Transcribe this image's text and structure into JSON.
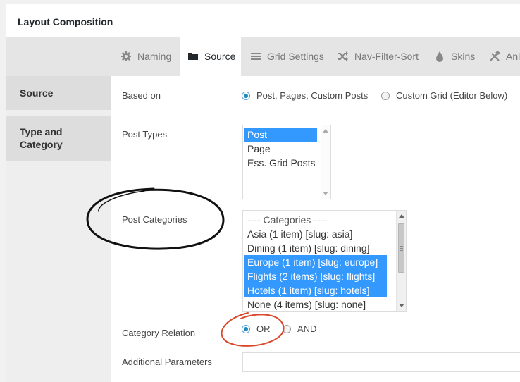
{
  "panel": {
    "title": "Layout Composition"
  },
  "tabs": [
    {
      "label": "Naming",
      "icon": "gear-icon",
      "active": false
    },
    {
      "label": "Source",
      "icon": "folder-icon",
      "active": true
    },
    {
      "label": "Grid Settings",
      "icon": "list-icon",
      "active": false
    },
    {
      "label": "Nav-Filter-Sort",
      "icon": "shuffle-icon",
      "active": false
    },
    {
      "label": "Skins",
      "icon": "drop-icon",
      "active": false
    },
    {
      "label": "Ani",
      "icon": "tools-icon",
      "active": false
    }
  ],
  "sidebar": {
    "items": [
      {
        "label": "Source"
      },
      {
        "label": "Type and Category"
      }
    ]
  },
  "form": {
    "based_on": {
      "label": "Based on",
      "options": [
        {
          "label": "Post, Pages, Custom Posts",
          "checked": true
        },
        {
          "label": "Custom Grid (Editor Below)",
          "checked": false
        }
      ]
    },
    "post_types": {
      "label": "Post Types",
      "options": [
        {
          "label": "Post",
          "selected": true
        },
        {
          "label": "Page",
          "selected": false
        },
        {
          "label": "Ess. Grid Posts",
          "selected": false
        }
      ]
    },
    "post_categories": {
      "label": "Post Categories",
      "options": [
        {
          "label": "---- Categories ----",
          "selected": false
        },
        {
          "label": "Asia (1 item) [slug: asia]",
          "selected": false
        },
        {
          "label": "Dining (1 item) [slug: dining]",
          "selected": false
        },
        {
          "label": "Europe (1 item) [slug: europe]",
          "selected": true
        },
        {
          "label": "Flights (2 items) [slug: flights]",
          "selected": true
        },
        {
          "label": "Hotels (1 item) [slug: hotels]",
          "selected": true
        },
        {
          "label": "None (4 items) [slug: none]",
          "selected": false
        }
      ]
    },
    "category_relation": {
      "label": "Category Relation",
      "options": [
        {
          "label": "OR",
          "checked": true
        },
        {
          "label": "AND",
          "checked": false
        }
      ]
    },
    "additional_parameters": {
      "label": "Additional Parameters",
      "value": ""
    }
  },
  "colors": {
    "selection": "#3399ff",
    "annotation_black": "#111111",
    "annotation_red": "#d9482b"
  }
}
